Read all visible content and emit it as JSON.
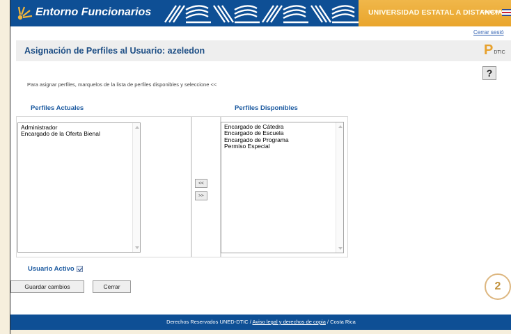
{
  "header": {
    "title": "Entorno Funcionarios",
    "university": "UNIVERSIDAD ESTATAL A DISTANCIA",
    "country": "Costa Rica",
    "brand_color": "#0e4f95",
    "accent_color": "#e9a52c"
  },
  "logout_link": "Cerrar sesió",
  "page": {
    "title": "Asignación de Perfiles al Usuario: azeledon",
    "dtic_logo_text": "DTIC",
    "help_label": "?",
    "instruction": "Para asignar perfiles, marquelos de la lista de perfiles disponibles y seleccione <<"
  },
  "current_profiles": {
    "title": "Perfiles Actuales",
    "items": [
      "Administrador",
      "Encargado de la Oferta Bienal"
    ]
  },
  "available_profiles": {
    "title": "Perfiles Disponibles",
    "items": [
      "Encargado de Cátedra",
      "Encargado de Escuela",
      "Encargado de Programa",
      "Permiso Especial"
    ]
  },
  "move_buttons": {
    "add": "<<",
    "remove": ">>"
  },
  "active_user": {
    "label": "Usuario Activo",
    "checked": true
  },
  "actions": {
    "save": "Guardar cambios",
    "close": "Cerrar"
  },
  "step_badge": "2",
  "footer": {
    "rights": "Derechos Reservados UNED-DTIC /",
    "legal_link": "Aviso legal y derechos de copia",
    "country": "/ Costa Rica"
  }
}
